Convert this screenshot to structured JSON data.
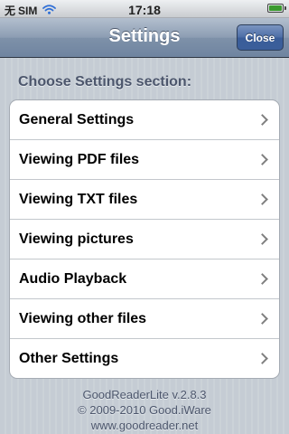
{
  "status_bar": {
    "carrier_prefix": "无",
    "carrier": "SIM",
    "time": "17:18",
    "wifi_icon": "wifi-icon",
    "battery_icon": "battery-icon",
    "battery_level": 1.0,
    "battery_color": "#3a9a2e"
  },
  "nav": {
    "title": "Settings",
    "close_label": "Close"
  },
  "section_header": "Choose Settings section:",
  "items": [
    {
      "label": "General Settings"
    },
    {
      "label": "Viewing PDF files"
    },
    {
      "label": "Viewing TXT files"
    },
    {
      "label": "Viewing pictures"
    },
    {
      "label": "Audio Playback"
    },
    {
      "label": "Viewing other files"
    },
    {
      "label": "Other Settings"
    }
  ],
  "footer": {
    "version": "GoodReaderLite v.2.8.3",
    "copyright": "© 2009-2010 Good.iWare",
    "website": "www.goodreader.net"
  },
  "colors": {
    "nav_bar": "#8c9db3",
    "close_button": "#4c6da6",
    "background": "#c5ccd4",
    "section_text": "#4c566c"
  }
}
